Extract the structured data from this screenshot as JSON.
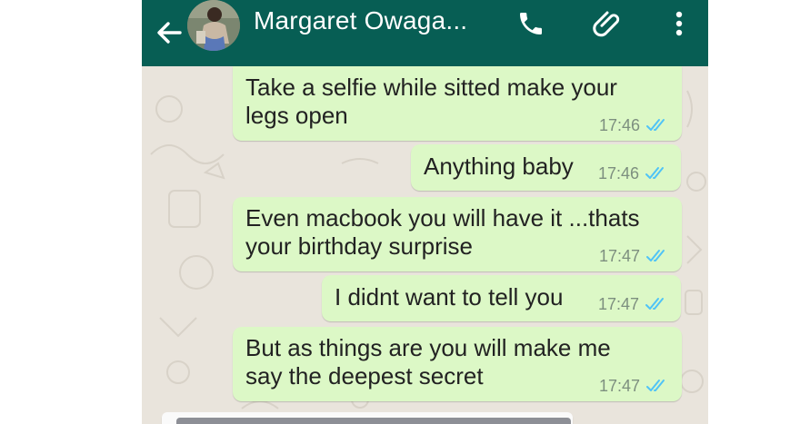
{
  "header": {
    "contact_name": "Margaret Owaga...",
    "background": "#075e54",
    "icons": [
      "back-arrow-icon",
      "phone-icon",
      "paperclip-icon",
      "more-vertical-icon"
    ]
  },
  "messages": [
    {
      "line1": "Take a selfie while sitted make your",
      "line2": "legs open",
      "time": "17:46"
    },
    {
      "line1": "Anything baby",
      "time": "17:46"
    },
    {
      "line1": "Even macbook you will have it ...thats",
      "line2": "your birthday surprise",
      "time": "17:47"
    },
    {
      "line1": "I didnt want to tell you",
      "time": "17:47"
    },
    {
      "line1": "But as things are you will make me",
      "line2": "say the deepest secret",
      "time": "17:47"
    }
  ],
  "colors": {
    "outgoing_bubble": "#dcf8c6",
    "read_ticks": "#4fc3f7",
    "wallpaper": "#e9e4dc"
  }
}
